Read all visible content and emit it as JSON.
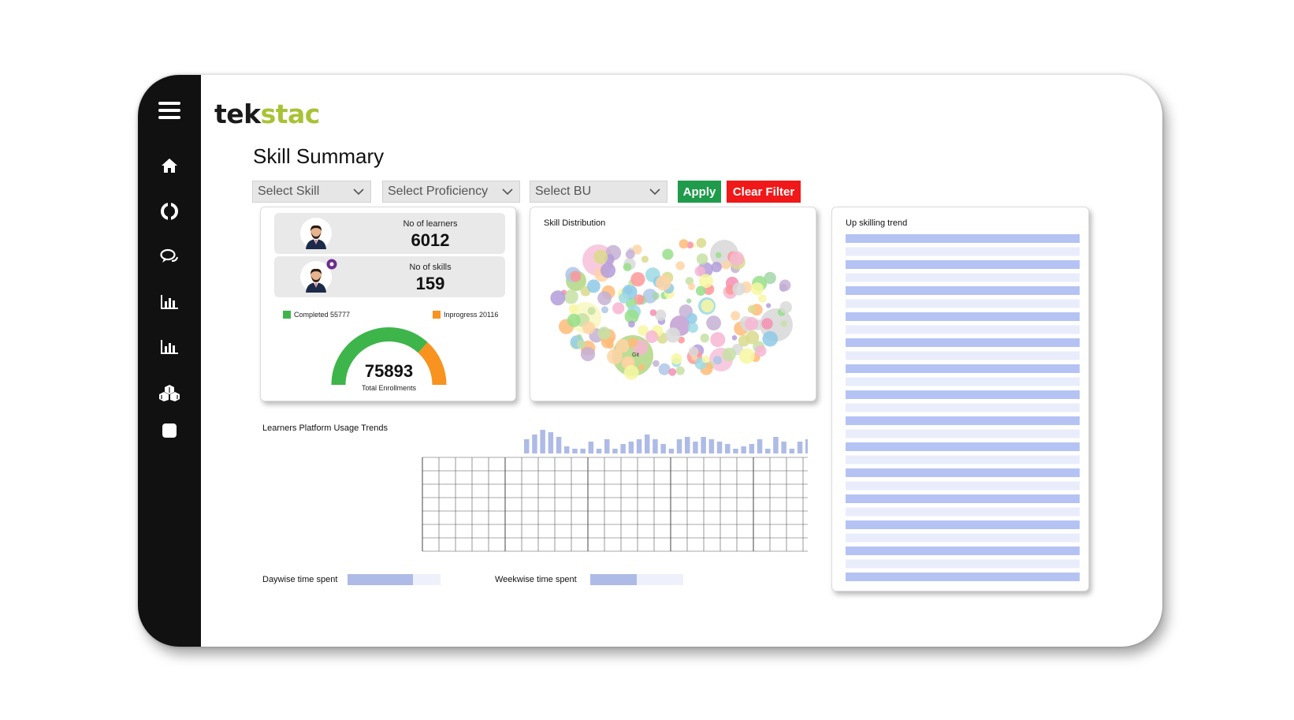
{
  "logo": {
    "part1": "tek",
    "part2": "stac"
  },
  "page_title": "Skill Summary",
  "filters": {
    "skill": "Select Skill",
    "proficiency": "Select Proficiency",
    "bu": "Select BU",
    "apply_label": "Apply",
    "clear_label": "Clear Filter"
  },
  "nav_icons": [
    "menu-icon",
    "home-icon",
    "lifebuoy-icon",
    "chat-icon",
    "bar-chart-icon",
    "bar-chart-icon",
    "cubes-icon",
    "square-icon"
  ],
  "stats": {
    "learners_label": "No of learners",
    "learners_value": "6012",
    "skills_label": "No of skills",
    "skills_value": "159"
  },
  "enrollment": {
    "completed_label": "Completed 55777",
    "inprogress_label": "Inprogress 20116",
    "total_value": "75893",
    "total_label": "Total Enrollments",
    "completed": 55777,
    "inprogress": 20116,
    "completed_color": "#3db54a",
    "inprogress_color": "#f7931e"
  },
  "skill_distribution": {
    "title": "Skill Distribution",
    "bubble_label": "Git"
  },
  "upskilling": {
    "title": "Up skilling trend"
  },
  "usage": {
    "title": "Learners Platform Usage Trends",
    "bars": [
      6,
      8,
      10,
      9,
      7,
      3,
      2,
      2,
      5,
      2,
      6,
      2,
      4,
      5,
      6,
      8,
      6,
      4,
      2,
      6,
      7,
      5,
      7,
      6,
      5,
      4,
      2,
      3,
      4,
      6,
      2,
      7,
      5,
      2,
      5,
      6,
      8,
      7,
      4,
      2,
      1
    ]
  },
  "daywise": {
    "label": "Daywise time spent",
    "fill": 0.7
  },
  "weekwise": {
    "label": "Weekwise time spent",
    "fill": 0.5
  },
  "colors": {
    "sidebar": "#111111",
    "accent_green": "#a8c236",
    "apply": "#1f9b4b",
    "clear": "#f01818",
    "bar": "#aebbe6",
    "stripe": "#dfe3fa"
  }
}
